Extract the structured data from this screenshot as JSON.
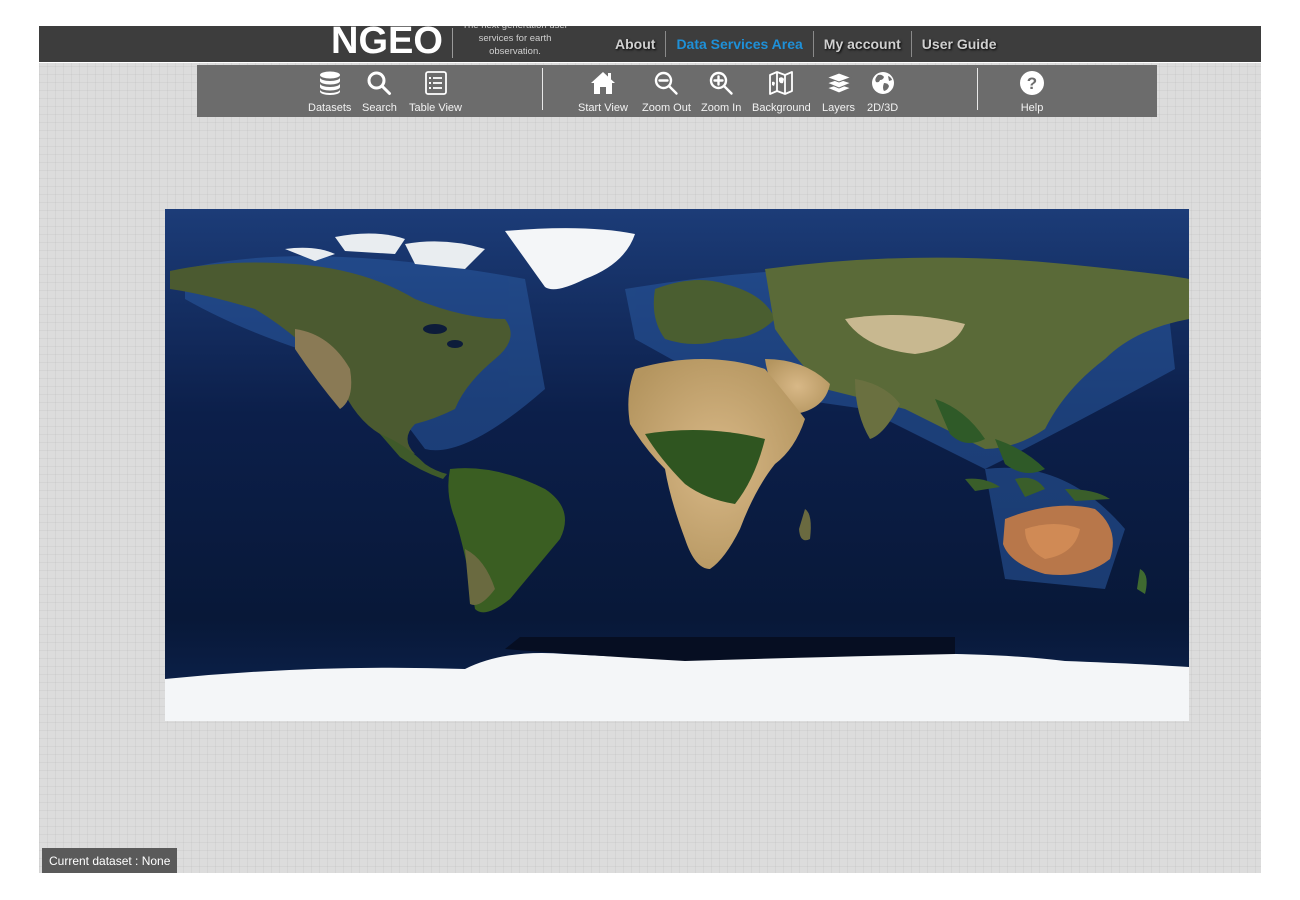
{
  "header": {
    "logo": "NGEO",
    "tagline": "The next generation user services for earth observation.",
    "nav": [
      {
        "label": "About",
        "active": false
      },
      {
        "label": "Data Services Area",
        "active": true
      },
      {
        "label": "My account",
        "active": false
      },
      {
        "label": "User Guide",
        "active": false
      }
    ]
  },
  "toolbar": {
    "datasets": {
      "label": "Datasets",
      "icon": "database-icon"
    },
    "search": {
      "label": "Search",
      "icon": "search-icon"
    },
    "table_view": {
      "label": "Table View",
      "icon": "list-icon"
    },
    "start_view": {
      "label": "Start View",
      "icon": "home-icon"
    },
    "zoom_out": {
      "label": "Zoom Out",
      "icon": "zoom-out-icon"
    },
    "zoom_in": {
      "label": "Zoom In",
      "icon": "zoom-in-icon"
    },
    "background": {
      "label": "Background",
      "icon": "map-icon"
    },
    "layers": {
      "label": "Layers",
      "icon": "layers-icon"
    },
    "view_mode": {
      "label": "2D/3D",
      "icon": "globe-icon"
    },
    "help": {
      "label": "Help",
      "icon": "help-icon"
    }
  },
  "status": {
    "current_dataset": "Current dataset : None"
  },
  "colors": {
    "header_bg": "#3d3d3d",
    "toolbar_bg": "#6c6c6c",
    "active_nav": "#1e90d8",
    "ocean": "#0a1a3a"
  }
}
